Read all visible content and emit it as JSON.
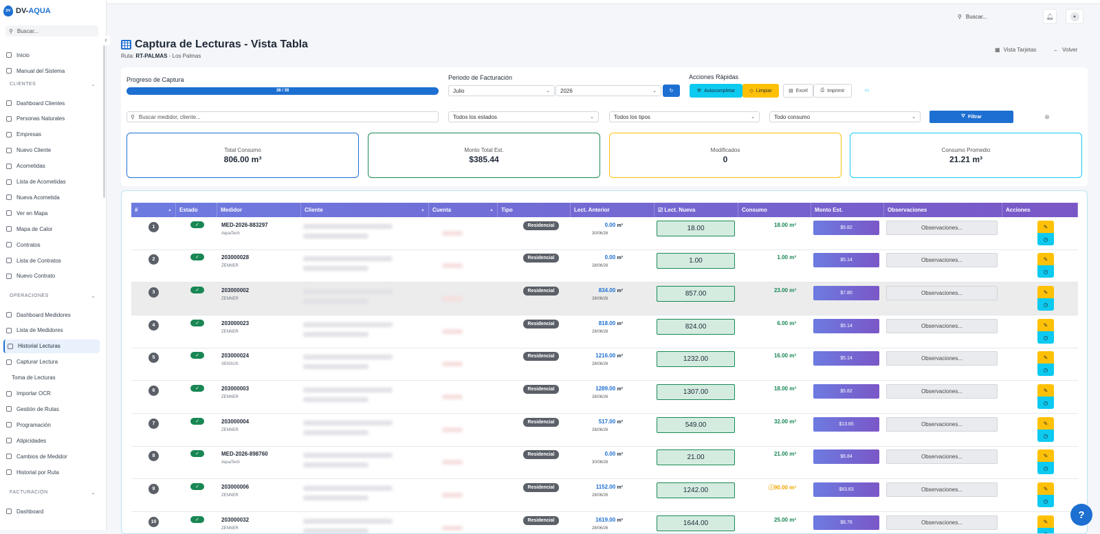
{
  "app": {
    "logo_text_a": "DV-",
    "logo_text_b": "AQUA",
    "logo_badge": "DV"
  },
  "sidebar": {
    "search_placeholder": "Buscar...",
    "top_items": [
      {
        "label": "Inicio",
        "icon": "home-icon"
      },
      {
        "label": "Manual del Sistema",
        "icon": "book-icon"
      }
    ],
    "sections": [
      {
        "title": "CLIENTES",
        "items": [
          "Dashboard Clientes",
          "Personas Naturales",
          "Empresas",
          "Nuevo Cliente",
          "Acometidas",
          "Lista de Acometidas",
          "Nueva Acometida",
          "Ver en Mapa",
          "Mapa de Calor",
          "Contratos",
          "Lista de Contratos",
          "Nuevo Contrato"
        ]
      },
      {
        "title": "OPERACIONES",
        "items": [
          "Dashboard Medidores",
          "Lista de Medidores",
          "Historial Lecturas",
          "Capturar Lectura",
          "Toma de Lecturas",
          "Importar OCR",
          "Gestión de Rutas",
          "Programación",
          "Atipicidades",
          "Cambios de Medidor",
          "Historial por Ruta"
        ]
      },
      {
        "title": "FACTURACIÓN",
        "items": [
          "Dashboard"
        ]
      }
    ],
    "active_item": "Historial Lecturas"
  },
  "topbar": {
    "search_placeholder": "Buscar..."
  },
  "header": {
    "title": "Captura de Lecturas - Vista Tabla",
    "ruta_label": "Ruta:",
    "ruta_code": "RT-PALMAS",
    "ruta_name": "- Los Palmas",
    "vista_tarjetas": "Vista Tarjetas",
    "volver": "Volver"
  },
  "progress": {
    "label": "Progreso de Captura",
    "text": "38 / 38",
    "value": 1.0
  },
  "periodo": {
    "label": "Periodo de Facturación",
    "mes": "Julio",
    "anio": "2026"
  },
  "acciones": {
    "label": "Acciones Rápidas",
    "autocompletar": "Autocompletar",
    "limpiar": "Limpiar",
    "excel": "Excel",
    "imprimir": "Imprimir"
  },
  "filters": {
    "search_placeholder": "Buscar medidor, cliente...",
    "estado": "Todos los estados",
    "tipo": "Todos los tipos",
    "consumo": "Todo consumo",
    "filtrar": "Filtrar"
  },
  "stats": [
    {
      "title": "Total Consumo",
      "value": "806.00 m³",
      "color": "#1d6fd1"
    },
    {
      "title": "Monto Total Est.",
      "value": "$385.44",
      "color": "#198754"
    },
    {
      "title": "Modificados",
      "value": "0",
      "color": "#ffc107"
    },
    {
      "title": "Consumo Promedio",
      "value": "21.21 m³",
      "color": "#0dcaf0"
    }
  ],
  "table": {
    "columns": [
      "#",
      "Estado",
      "Medidor",
      "Cliente",
      "Cuenta",
      "Tipo",
      "Lect. Anterior",
      "Lect. Nueva",
      "Consumo",
      "Monto Est.",
      "Observaciones",
      "Acciones"
    ],
    "rows": [
      {
        "n": "1",
        "medidor": "MED-2026-883297",
        "marca": "AquaTech",
        "tipo": "Residencial",
        "la": "0.00",
        "fecha": "30/06/26",
        "ln": "18.00",
        "consumo": "18.00 m³",
        "monto": "$5.82",
        "obs": "Observaciones..."
      },
      {
        "n": "2",
        "medidor": "203000028",
        "marca": "ZENNER",
        "tipo": "Residencial",
        "la": "0.00",
        "fecha": "28/06/26",
        "ln": "1.00",
        "consumo": "1.00 m³",
        "monto": "$5.14",
        "obs": "Observaciones..."
      },
      {
        "n": "3",
        "medidor": "203000002",
        "marca": "ZENNER",
        "tipo": "Residencial",
        "la": "834.00",
        "fecha": "28/06/26",
        "ln": "857.00",
        "consumo": "23.00 m³",
        "monto": "$7.80",
        "obs": "Observaciones..."
      },
      {
        "n": "4",
        "medidor": "203000023",
        "marca": "ZENNER",
        "tipo": "Residencial",
        "la": "818.00",
        "fecha": "28/06/26",
        "ln": "824.00",
        "consumo": "6.00 m³",
        "monto": "$5.14",
        "obs": "Observaciones..."
      },
      {
        "n": "5",
        "medidor": "203000024",
        "marca": "SENSUS",
        "tipo": "Residencial",
        "la": "1216.00",
        "fecha": "28/06/26",
        "ln": "1232.00",
        "consumo": "16.00 m³",
        "monto": "$5.14",
        "obs": "Observaciones..."
      },
      {
        "n": "6",
        "medidor": "203000003",
        "marca": "ZENNER",
        "tipo": "Residencial",
        "la": "1289.00",
        "fecha": "28/06/26",
        "ln": "1307.00",
        "consumo": "18.00 m³",
        "monto": "$5.82",
        "obs": "Observaciones..."
      },
      {
        "n": "7",
        "medidor": "203000004",
        "marca": "ZENNER",
        "tipo": "Residencial",
        "la": "517.00",
        "fecha": "28/06/26",
        "ln": "549.00",
        "consumo": "32.00 m³",
        "monto": "$13.65",
        "obs": "Observaciones..."
      },
      {
        "n": "8",
        "medidor": "MED-2026-898760",
        "marca": "AquaTech",
        "tipo": "Residencial",
        "la": "0.00",
        "fecha": "30/06/26",
        "ln": "21.00",
        "consumo": "21.00 m³",
        "monto": "$6.84",
        "obs": "Observaciones..."
      },
      {
        "n": "9",
        "medidor": "203000006",
        "marca": "ZENNER",
        "tipo": "Residencial",
        "la": "1152.00",
        "fecha": "28/06/26",
        "ln": "1242.00",
        "consumo": "90.00 m³",
        "monto": "$83.83",
        "obs": "Observaciones...",
        "warn": true
      },
      {
        "n": "10",
        "medidor": "203000032",
        "marca": "ZENNER",
        "tipo": "Residencial",
        "la": "1619.00",
        "fecha": "28/06/26",
        "ln": "1644.00",
        "consumo": "25.00 m³",
        "monto": "$8.76",
        "obs": "Observaciones..."
      }
    ],
    "unit": "m³"
  },
  "help": "?"
}
